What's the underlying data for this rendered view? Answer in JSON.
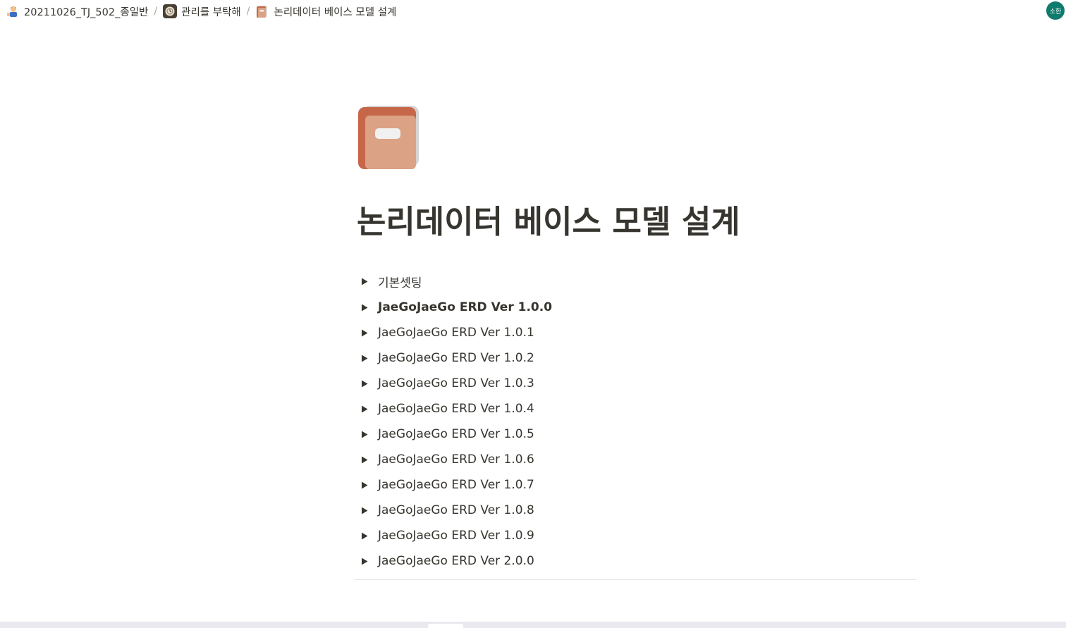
{
  "breadcrumb": {
    "items": [
      {
        "label": "20211026_TJ_502_종일반",
        "icon": "person-emoji-icon"
      },
      {
        "label": "관리를 부탁해",
        "icon": "clock-badge-icon"
      },
      {
        "label": "논리데이터 베이스 모델 설계",
        "icon": "book-icon"
      }
    ],
    "separator": "/"
  },
  "user": {
    "avatar_text": "소한",
    "avatar_color": "#0f7b6c"
  },
  "page": {
    "icon": "book-icon",
    "title": "논리데이터 베이스 모델 설계"
  },
  "toggles": [
    {
      "label": "기본셋팅",
      "bold": false
    },
    {
      "label": "JaeGoJaeGo ERD Ver 1.0.0",
      "bold": true
    },
    {
      "label": "JaeGoJaeGo ERD Ver 1.0.1",
      "bold": false
    },
    {
      "label": "JaeGoJaeGo ERD Ver 1.0.2",
      "bold": false
    },
    {
      "label": "JaeGoJaeGo ERD Ver 1.0.3",
      "bold": false
    },
    {
      "label": "JaeGoJaeGo ERD Ver 1.0.4",
      "bold": false
    },
    {
      "label": "JaeGoJaeGo ERD Ver 1.0.5",
      "bold": false
    },
    {
      "label": "JaeGoJaeGo ERD Ver 1.0.6",
      "bold": false
    },
    {
      "label": "JaeGoJaeGo ERD Ver 1.0.7",
      "bold": false
    },
    {
      "label": "JaeGoJaeGo ERD Ver 1.0.8",
      "bold": false
    },
    {
      "label": "JaeGoJaeGo ERD Ver 1.0.9",
      "bold": false
    },
    {
      "label": "JaeGoJaeGo ERD Ver 2.0.0",
      "bold": false
    }
  ],
  "colors": {
    "text": "#37352f",
    "book_cover": "#c7674a",
    "book_front": "#dba285",
    "divider": "#e3e2e0"
  }
}
